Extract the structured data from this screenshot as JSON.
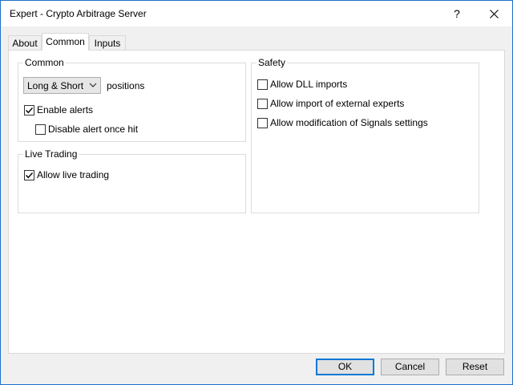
{
  "window": {
    "title": "Expert - Crypto Arbitrage Server",
    "help_label": "?"
  },
  "tabs": [
    {
      "label": "About"
    },
    {
      "label": "Common",
      "active": true
    },
    {
      "label": "Inputs"
    }
  ],
  "common": {
    "group_title": "Common",
    "positions_select": {
      "value": "Long & Short"
    },
    "positions_label": "positions",
    "enable_alerts": {
      "label": "Enable alerts",
      "checked": true
    },
    "disable_alert_once_hit": {
      "label": "Disable alert once hit",
      "checked": false
    }
  },
  "live_trading": {
    "group_title": "Live Trading",
    "allow_live_trading": {
      "label": "Allow live trading",
      "checked": true
    }
  },
  "safety": {
    "group_title": "Safety",
    "allow_dll_imports": {
      "label": "Allow DLL imports",
      "checked": false
    },
    "allow_import_external": {
      "label": "Allow import of external experts",
      "checked": false
    },
    "allow_signals_modification": {
      "label": "Allow modification of Signals settings",
      "checked": false
    }
  },
  "buttons": {
    "ok": "OK",
    "cancel": "Cancel",
    "reset": "Reset"
  },
  "colors": {
    "accent": "#0078d7",
    "window_border": "#1f6fc7"
  }
}
